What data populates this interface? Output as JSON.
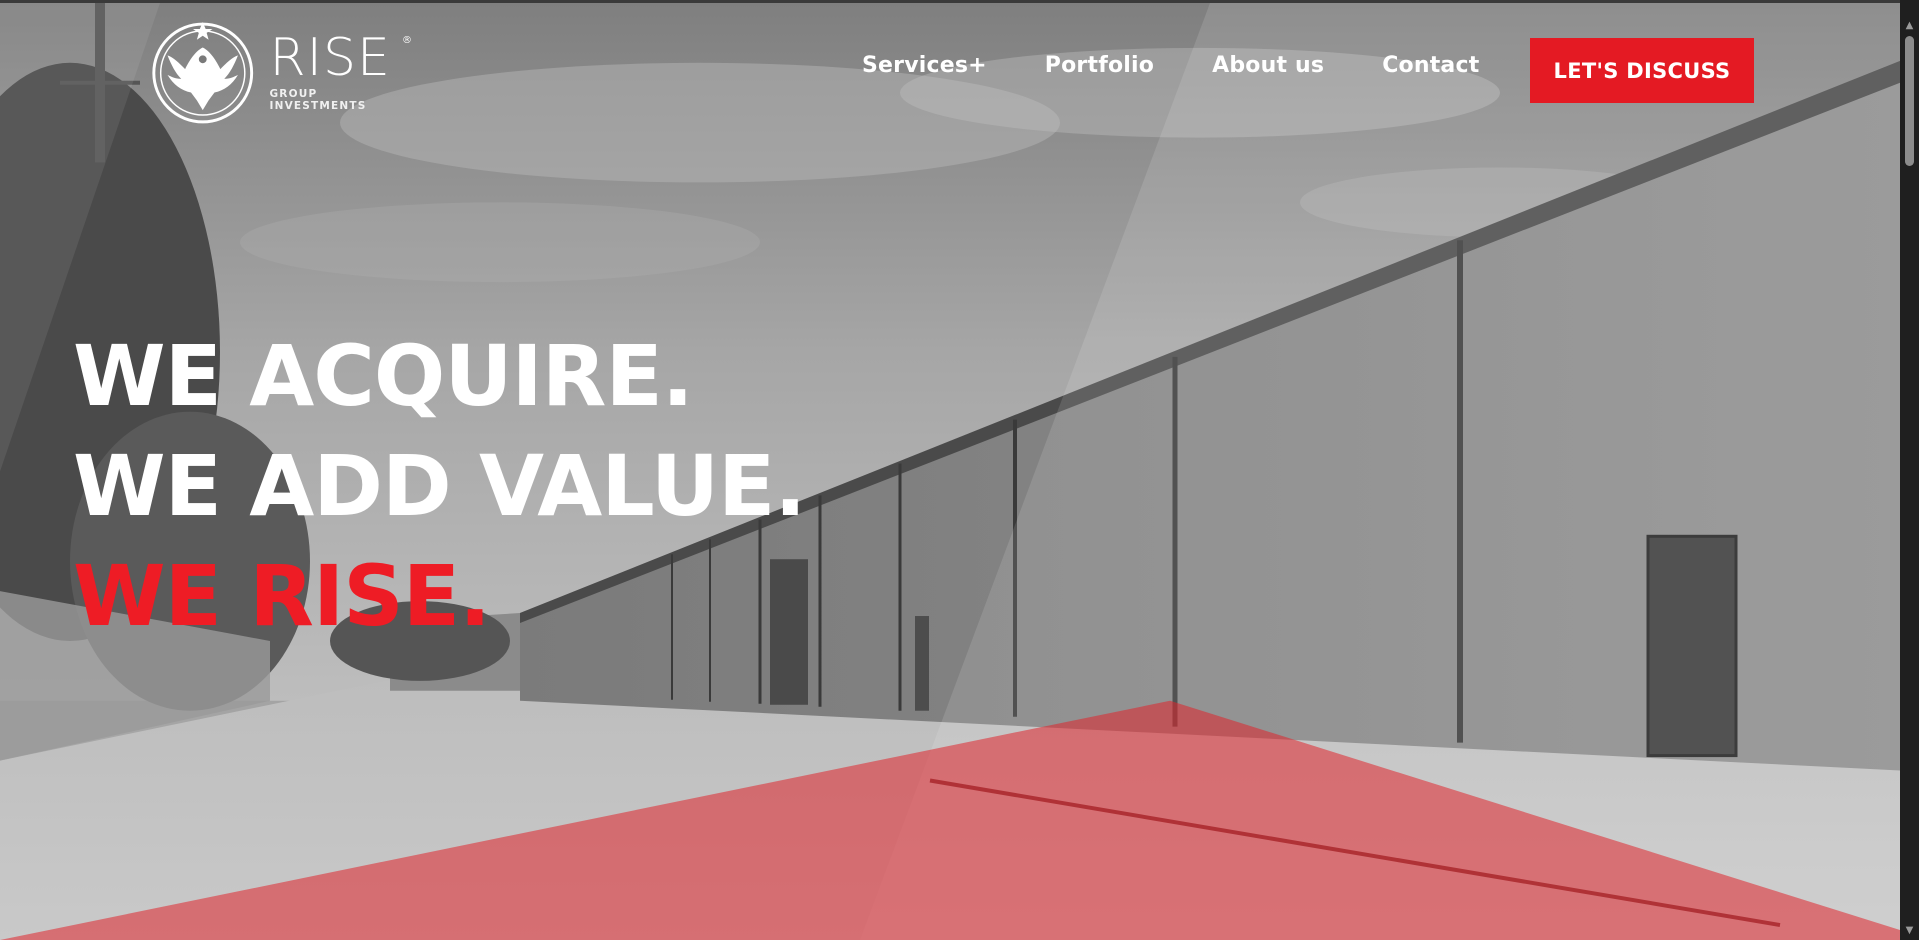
{
  "brand": {
    "name": "RISE",
    "tagline": "GROUP INVESTMENTS",
    "registered": "®"
  },
  "nav": {
    "items": [
      {
        "label": "Services+",
        "name": "nav-services"
      },
      {
        "label": "Portfolio",
        "name": "nav-portfolio"
      },
      {
        "label": "About us",
        "name": "nav-about"
      },
      {
        "label": "Contact",
        "name": "nav-contact"
      }
    ],
    "cta_label": "LET'S DISCUSS"
  },
  "hero": {
    "line1": "WE ACQUIRE.",
    "line2": "WE ADD VALUE.",
    "line3": "WE RISE."
  },
  "colors": {
    "accent": "#e41a23",
    "headline_red": "#ee1c25",
    "text": "#ffffff"
  },
  "icons": {
    "logo": "phoenix-emblem-icon",
    "scroll_up": "chevron-up-icon",
    "scroll_down": "chevron-down-icon"
  }
}
